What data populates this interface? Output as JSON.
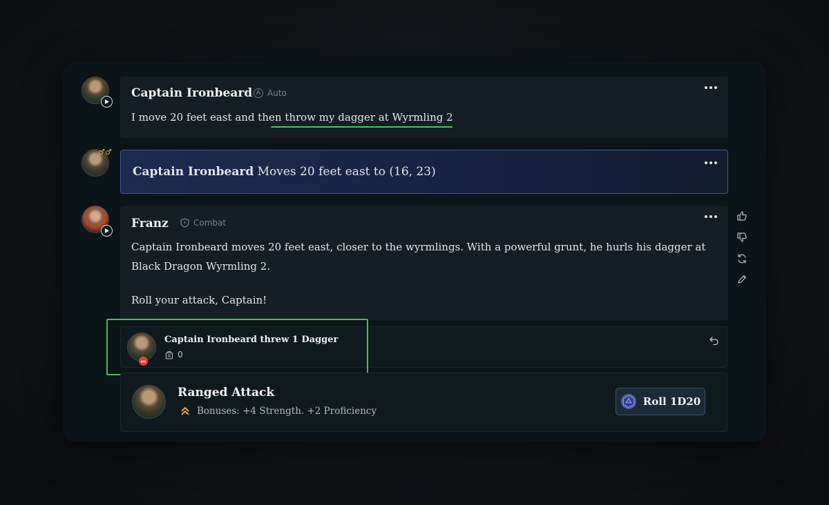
{
  "messages": [
    {
      "author": "Captain Ironbeard",
      "tag": "Auto",
      "tag_icon": "a-circle-icon",
      "text_plain": "I move 20 feet east and then ",
      "text_highlight": "throw my dagger at Wyrmling 2"
    },
    {
      "author": "Captain Ironbeard",
      "action": "Moves 20 feet east to (16, 23)"
    },
    {
      "author": "Franz",
      "tag": "Combat",
      "tag_icon": "shield-icon",
      "paragraph1": "Captain Ironbeard moves 20 feet east, closer to the wyrmlings. With a powerful grunt, he hurls his dagger at Black Dragon Wyrmling 2.",
      "paragraph2": "Roll your attack, Captain!"
    }
  ],
  "item_event": {
    "title": "Captain Ironbeard threw 1 Dagger",
    "count": "0"
  },
  "attack": {
    "title": "Ranged Attack",
    "bonuses": "Bonuses: +4 Strength. +2 Proficiency",
    "roll_label": "Roll 1D20"
  },
  "colors": {
    "highlight_green": "#43c24a",
    "move_blue": "#1c2a4e",
    "bonus_gold": "#e0a83a"
  }
}
